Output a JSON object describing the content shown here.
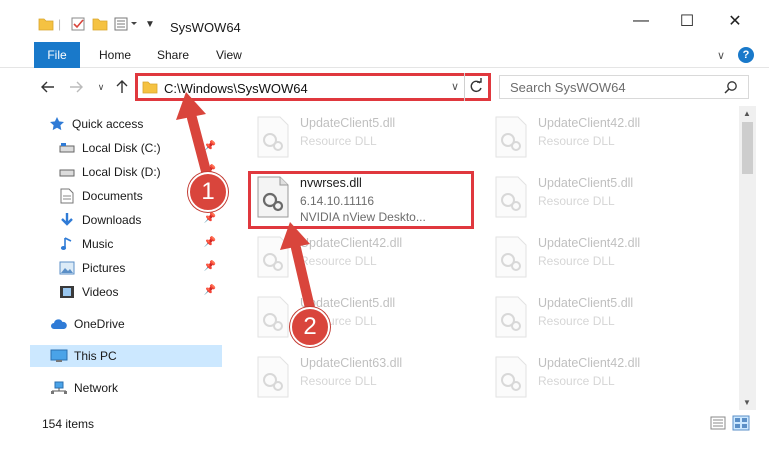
{
  "window": {
    "title": "SysWOW64",
    "minimize_glyph": "—",
    "maximize_glyph": "☐",
    "close_glyph": "✕",
    "help_glyph": "?",
    "expand_glyph": "∨"
  },
  "ribbon": {
    "tabs": [
      "File",
      "Home",
      "Share",
      "View"
    ]
  },
  "address_bar": {
    "path": "C:\\Windows\\SysWOW64"
  },
  "search": {
    "placeholder": "Search SysWOW64"
  },
  "nav_pane": {
    "items": [
      {
        "label": "Quick access",
        "icon": "star-icon"
      },
      {
        "label": "Local Disk (C:)",
        "icon": "drive-icon",
        "pinned": true
      },
      {
        "label": "Local Disk (D:)",
        "icon": "drive-icon",
        "pinned": true
      },
      {
        "label": "Documents",
        "icon": "documents-icon",
        "pinned": true
      },
      {
        "label": "Downloads",
        "icon": "download-icon",
        "pinned": true
      },
      {
        "label": "Music",
        "icon": "music-icon",
        "pinned": true
      },
      {
        "label": "Pictures",
        "icon": "pictures-icon",
        "pinned": true
      },
      {
        "label": "Videos",
        "icon": "videos-icon",
        "pinned": true
      },
      {
        "label": "OneDrive",
        "icon": "cloud-icon"
      },
      {
        "label": "This PC",
        "icon": "computer-icon",
        "selected": true
      },
      {
        "label": "Network",
        "icon": "network-icon"
      }
    ]
  },
  "files": [
    {
      "name": "UpdateClient5.dll",
      "type": "Resource DLL",
      "faded": true
    },
    {
      "name": "UpdateClient42.dll",
      "type": "Resource DLL",
      "faded": true
    },
    {
      "name": "nvwrses.dll",
      "version": "6.14.10.11116",
      "description": "NVIDIA nView Deskto...",
      "faded": false
    },
    {
      "name": "UpdateClient5.dll",
      "type": "Resource DLL",
      "faded": true
    },
    {
      "name": "UpdateClient42.dll",
      "type": "Resource DLL",
      "faded": true
    },
    {
      "name": "UpdateClient42.dll",
      "type": "Resource DLL",
      "faded": true
    },
    {
      "name": "UpdateClient5.dll",
      "type": "Resource DLL",
      "faded": true
    },
    {
      "name": "UpdateClient5.dll",
      "type": "Resource DLL",
      "faded": true
    },
    {
      "name": "UpdateClient63.dll",
      "type": "Resource DLL",
      "faded": true
    },
    {
      "name": "UpdateClient42.dll",
      "type": "Resource DLL",
      "faded": true
    }
  ],
  "status_bar": {
    "item_count": "154 items"
  },
  "annotations": [
    {
      "label": "1"
    },
    {
      "label": "2"
    }
  ],
  "colors": {
    "accent": "#1979ca",
    "highlight_border": "#e0383e",
    "badge": "#d9453c",
    "selected_bg": "#cce8ff"
  }
}
